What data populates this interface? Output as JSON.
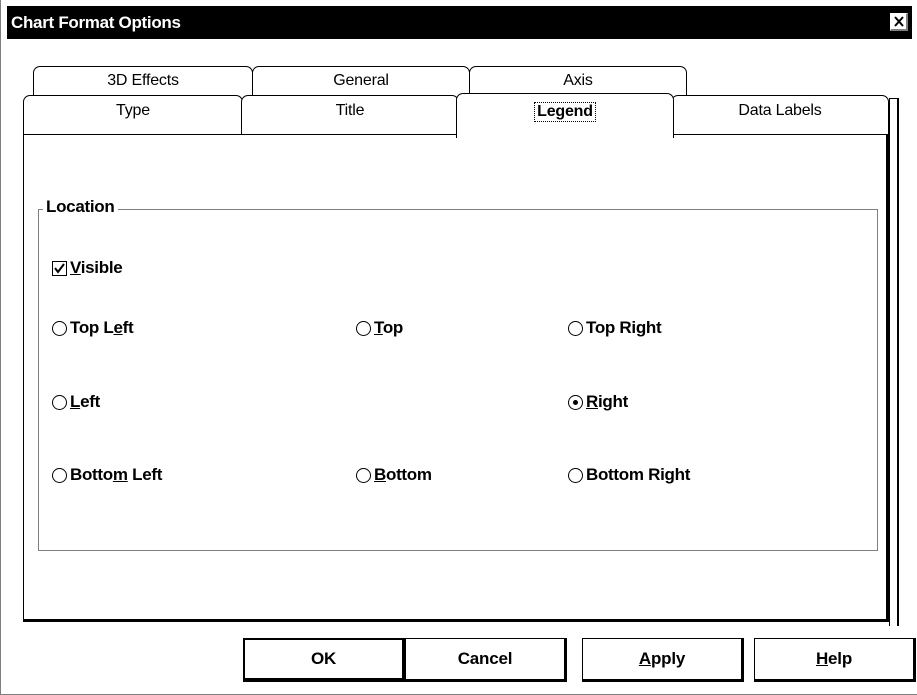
{
  "window": {
    "title": "Chart Format Options",
    "close_icon": "close-icon"
  },
  "tabs": {
    "back_row": [
      {
        "label": "3D Effects"
      },
      {
        "label": "General"
      },
      {
        "label": "Axis"
      }
    ],
    "front_row": [
      {
        "label": "Type"
      },
      {
        "label": "Title"
      },
      {
        "label": "Legend",
        "selected": true
      },
      {
        "label": "Data Labels"
      }
    ]
  },
  "location_group": {
    "label": "Location",
    "visible_checkbox": {
      "label": "Visible",
      "mnemonic": "V",
      "checked": true
    },
    "positions": [
      {
        "label": "Top Left",
        "mnemonic": "e",
        "selected": false
      },
      {
        "label": "Top",
        "mnemonic": "T",
        "selected": false
      },
      {
        "label": "Top Right",
        "mnemonic": "g",
        "selected": false
      },
      {
        "label": "Left",
        "mnemonic": "L",
        "selected": false
      },
      {
        "label": "Right",
        "mnemonic": "R",
        "selected": true
      },
      {
        "label": "Bottom Left",
        "mnemonic": "m",
        "selected": false
      },
      {
        "label": "Bottom",
        "mnemonic": "B",
        "selected": false
      },
      {
        "label": "Bottom Right",
        "mnemonic": "g",
        "selected": false
      }
    ]
  },
  "buttons": {
    "ok": "OK",
    "cancel": "Cancel",
    "apply": "Apply",
    "help": "Help"
  }
}
